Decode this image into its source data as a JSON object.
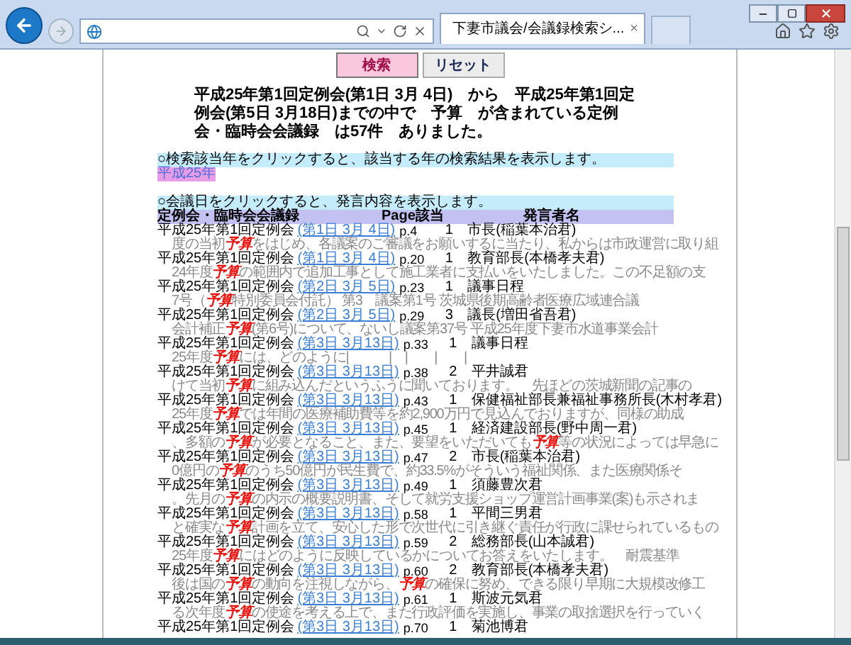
{
  "browser": {
    "tab_title": "下妻市議会/会議録検索シ...",
    "tab_close": "×"
  },
  "buttons": [
    {
      "label": "検索",
      "kind": "primary"
    },
    {
      "label": "リセット",
      "kind": "secondary"
    }
  ],
  "summary": "平成25年第1回定例会(第1日 3月 4日)　から　平成25年第1回定例会(第5日 3月18日)までの中で　予算　が含まれている定例会・臨時会会議録　は57件　ありました。",
  "year_notice": "○検索該当年をクリックすると、該当する年の検索結果を表示します。",
  "years": [
    {
      "label": "平成25年",
      "selected": true
    }
  ],
  "meeting_notice": "○会議日をクリックすると、発言内容を表示します。",
  "columns": [
    "定例会・臨時会会議録",
    "Page該当",
    "発言者名"
  ],
  "results": [
    {
      "session": "平成25年第1回定例会",
      "day": "(第1日 3月 4日)",
      "page": "p.4",
      "count": "1",
      "speaker": "市長(稲葉本治君)",
      "snippet": "度の当初**予算**をはじめ、各議案のご審議をお願いするに当たり、私からは市政運営に取り組"
    },
    {
      "session": "平成25年第1回定例会",
      "day": "(第1日 3月 4日)",
      "page": "p.20",
      "count": "1",
      "speaker": "教育部長(本橋孝夫君)",
      "snippet": "24年度**予算**の範囲内で追加工事として施工業者に支払いをいたしました。この不足額の支"
    },
    {
      "session": "平成25年第1回定例会",
      "day": "(第2日 3月 5日)",
      "page": "p.23",
      "count": "1",
      "speaker": "議事日程",
      "snippet": "7号（**予算**特別委員会付託） 第3　議案第1号 茨城県後期高齢者医療広域連合議"
    },
    {
      "session": "平成25年第1回定例会",
      "day": "(第2日 3月 5日)",
      "page": "p.29",
      "count": "3",
      "speaker": "議長(増田省吾君)",
      "snippet": "会計補正**予算**(第6号)について、ないし議案第37号 平成25年度下妻市水道事業会計"
    },
    {
      "session": "平成25年第1回定例会",
      "day": "(第3日 3月13日)",
      "page": "p.33",
      "count": "1",
      "speaker": "議事日程",
      "snippet": "25年度**予算**には、どのように|　　　|　|　　|　　|"
    },
    {
      "session": "平成25年第1回定例会",
      "day": "(第3日 3月13日)",
      "page": "p.38",
      "count": "2",
      "speaker": "平井誠君",
      "snippet": "けて当初**予算**に組み込んだというふうに聞いております。　先ほどの茨城新聞の記事の"
    },
    {
      "session": "平成25年第1回定例会",
      "day": "(第3日 3月13日)",
      "page": "p.43",
      "count": "1",
      "speaker": "保健福祉部長兼福祉事務所長(木村孝君)",
      "snippet": "25年度**予算**では年間の医療補助費等を約2,900万円で見込んでおりますが、同様の助成"
    },
    {
      "session": "平成25年第1回定例会",
      "day": "(第3日 3月13日)",
      "page": "p.45",
      "count": "1",
      "speaker": "経済建設部長(野中周一君)",
      "snippet": "、多額の**予算**が必要となること、また、要望をいただいても**予算**等の状況によっては早急に"
    },
    {
      "session": "平成25年第1回定例会",
      "day": "(第3日 3月13日)",
      "page": "p.47",
      "count": "2",
      "speaker": "市長(稲葉本治君)",
      "snippet": "0億円の**予算**のうち50億円が民生費で、約33.5%がそういう福祉関係、また医療関係そ"
    },
    {
      "session": "平成25年第1回定例会",
      "day": "(第3日 3月13日)",
      "page": "p.49",
      "count": "1",
      "speaker": "須藤豊次君",
      "snippet": "。先月の**予算**の内示の概要説明書、そして就労支援ショップ運営計画事業(案)も示されま"
    },
    {
      "session": "平成25年第1回定例会",
      "day": "(第3日 3月13日)",
      "page": "p.58",
      "count": "1",
      "speaker": "平間三男君",
      "snippet": "と確実な**予算**計画を立て、安心した形で次世代に引き継ぐ責任が行政に課せられているもの"
    },
    {
      "session": "平成25年第1回定例会",
      "day": "(第3日 3月13日)",
      "page": "p.59",
      "count": "2",
      "speaker": "総務部長(山本誠君)",
      "snippet": "25年度**予算**にはどのように反映しているかについてお答えをいたします。　耐震基準"
    },
    {
      "session": "平成25年第1回定例会",
      "day": "(第3日 3月13日)",
      "page": "p.60",
      "count": "2",
      "speaker": "教育部長(本橋孝夫君)",
      "snippet": "後は国の**予算**の動向を注視しながら、**予算**の確保に努め、できる限り早期に大規模改修工"
    },
    {
      "session": "平成25年第1回定例会",
      "day": "(第3日 3月13日)",
      "page": "p.61",
      "count": "1",
      "speaker": "斯波元気君",
      "snippet": "る次年度**予算**の使途を考える上で、また行政評価を実施し、事業の取捨選択を行っていく"
    },
    {
      "session": "平成25年第1回定例会",
      "day": "(第3日 3月13日)",
      "page": "p.70",
      "count": "1",
      "speaker": "菊池博君"
    }
  ]
}
